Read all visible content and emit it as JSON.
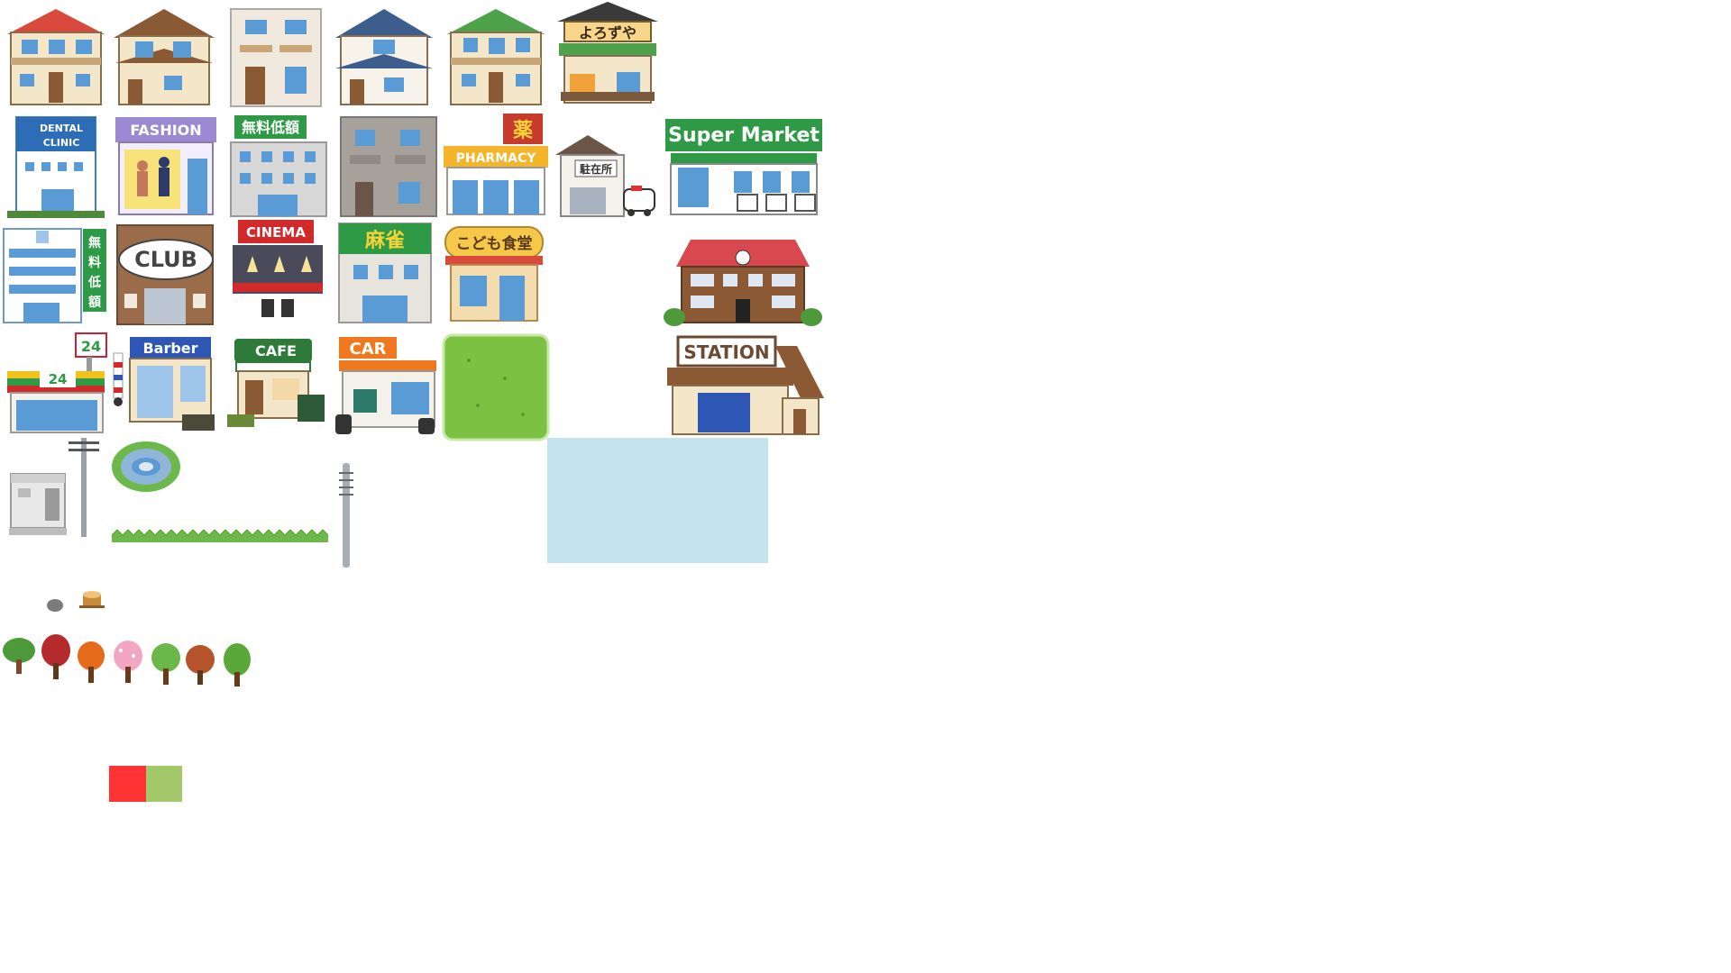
{
  "palette": {
    "roof_red": "#d94a3c",
    "roof_brown": "#8a5a35",
    "roof_blue": "#3d5d8c",
    "roof_green": "#4ea24a",
    "wall_cream": "#f3e6c9",
    "wall_grey": "#c9c4bc",
    "window_blue": "#5b9bd5",
    "grass": "#7cc142",
    "pool": "#c5e3ec",
    "swatch_red": "#ff3333",
    "swatch_green": "#a3c96b"
  },
  "signs": {
    "yorozuya": "よろずや",
    "dental": "DENTAL",
    "clinic": "CLINIC",
    "fashion": "FASHION",
    "free_loan": "無料低額",
    "pharmacy_kanji": "薬",
    "pharmacy": "PHARMACY",
    "police_box": "駐在所",
    "supermarket": "Super Market",
    "free_loan_v": [
      "無",
      "料",
      "低",
      "額"
    ],
    "club": "CLUB",
    "cinema": "CINEMA",
    "mahjong": "麻雀",
    "kids_cafeteria": "こども食堂",
    "conbini_24": "24",
    "barber": "Barber",
    "cafe": "CAFE",
    "car": "CAR",
    "station": "STATION"
  }
}
